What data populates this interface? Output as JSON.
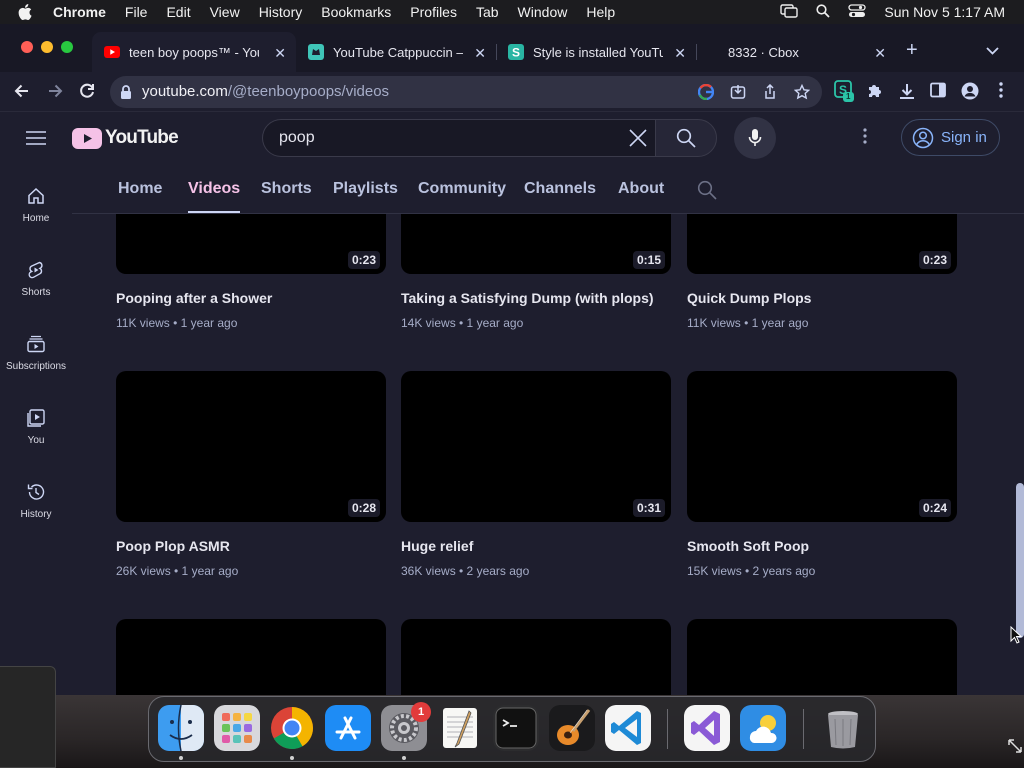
{
  "menubar": {
    "app": "Chrome",
    "items": [
      "File",
      "Edit",
      "View",
      "History",
      "Bookmarks",
      "Profiles",
      "Tab",
      "Window",
      "Help"
    ],
    "clock": "Sun Nov 5  1:17 AM"
  },
  "tabs": [
    {
      "title": "teen boy poops™ - YouTube",
      "icon": "youtube-icon"
    },
    {
      "title": "YouTube Catppuccin — Themes",
      "icon": "catppuccin-icon"
    },
    {
      "title": "Style is installed YouTube",
      "icon": "stylus-icon"
    },
    {
      "title": "8332 · Cbox",
      "icon": ""
    }
  ],
  "address": {
    "host": "youtube.com",
    "path": "/@teenboypoops/videos"
  },
  "extension_badge": "1",
  "youtube": {
    "logo_text": "YouTube",
    "search_query": "poop",
    "sign_in": "Sign in",
    "guide": [
      {
        "label": "Home",
        "icon": "home-icon"
      },
      {
        "label": "Shorts",
        "icon": "shorts-icon"
      },
      {
        "label": "Subscriptions",
        "icon": "subscriptions-icon"
      },
      {
        "label": "You",
        "icon": "you-icon"
      },
      {
        "label": "History",
        "icon": "history-icon"
      }
    ],
    "channel_tabs": [
      "Home",
      "Videos",
      "Shorts",
      "Playlists",
      "Community",
      "Channels",
      "About"
    ],
    "active_tab": "Videos",
    "videos": [
      {
        "duration": "0:23",
        "title": "Pooping after a Shower",
        "meta": "11K views • 1 year ago"
      },
      {
        "duration": "0:15",
        "title": "Taking a Satisfying Dump (with plops)",
        "meta": "14K views • 1 year ago"
      },
      {
        "duration": "0:23",
        "title": "Quick Dump Plops",
        "meta": "11K views • 1 year ago"
      },
      {
        "duration": "0:28",
        "title": "Poop Plop ASMR",
        "meta": "26K views • 1 year ago"
      },
      {
        "duration": "0:31",
        "title": "Huge relief",
        "meta": "36K views • 2 years ago"
      },
      {
        "duration": "0:24",
        "title": "Smooth Soft Poop",
        "meta": "15K views • 2 years ago"
      }
    ]
  },
  "dock": {
    "apps": [
      "finder",
      "launchpad",
      "chrome",
      "app-store",
      "system-settings",
      "textedit",
      "terminal",
      "garageband",
      "vscode",
      "visual-studio",
      "weather",
      "trash"
    ],
    "settings_badge": "1"
  },
  "colors": {
    "base": "#1e1e2e",
    "mantle": "#181825",
    "pink": "#f5c2e7",
    "blue": "#89b4fa",
    "text": "#cdd6f4"
  }
}
